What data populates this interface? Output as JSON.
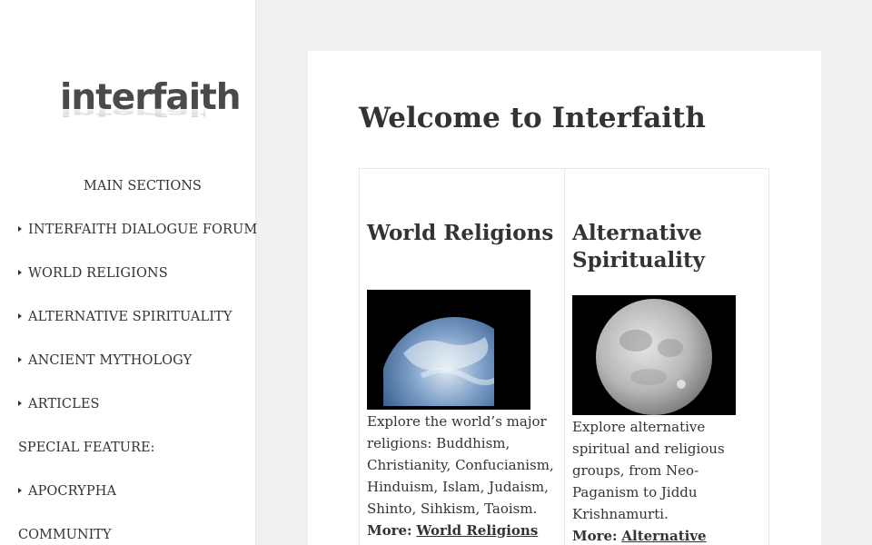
{
  "sidebar": {
    "logo": "interfaith",
    "heading": "MAIN SECTIONS",
    "items": [
      {
        "label": "INTERFAITH DIALOGUE FORUM"
      },
      {
        "label": "WORLD RELIGIONS"
      },
      {
        "label": "ALTERNATIVE SPIRITUALITY"
      },
      {
        "label": "ANCIENT MYTHOLOGY"
      },
      {
        "label": "ARTICLES"
      }
    ],
    "special_heading": "SPECIAL FEATURE:",
    "special_items": [
      {
        "label": "APOCRYPHA"
      }
    ],
    "community_heading": "COMMUNITY"
  },
  "main": {
    "title": "Welcome to Interfaith",
    "columns": [
      {
        "title": "World Religions",
        "image": "earth-image",
        "description": "Explore the world’s major re­ligions: Buddhism, Christianity, Confucianism, Hinduism, Islam, Judaism, Shinto, Sihkism, Taoism.",
        "more_label": "More:",
        "more_link": "World Religions"
      },
      {
        "title": "Alternative Spirituality",
        "image": "moon-image",
        "description": "Explore alternative spiritual and religious groups, from Neo-Paganism to Jiddu Krishnamurti.",
        "more_label": "More:",
        "more_link": "Alternative Spirituality"
      }
    ]
  }
}
